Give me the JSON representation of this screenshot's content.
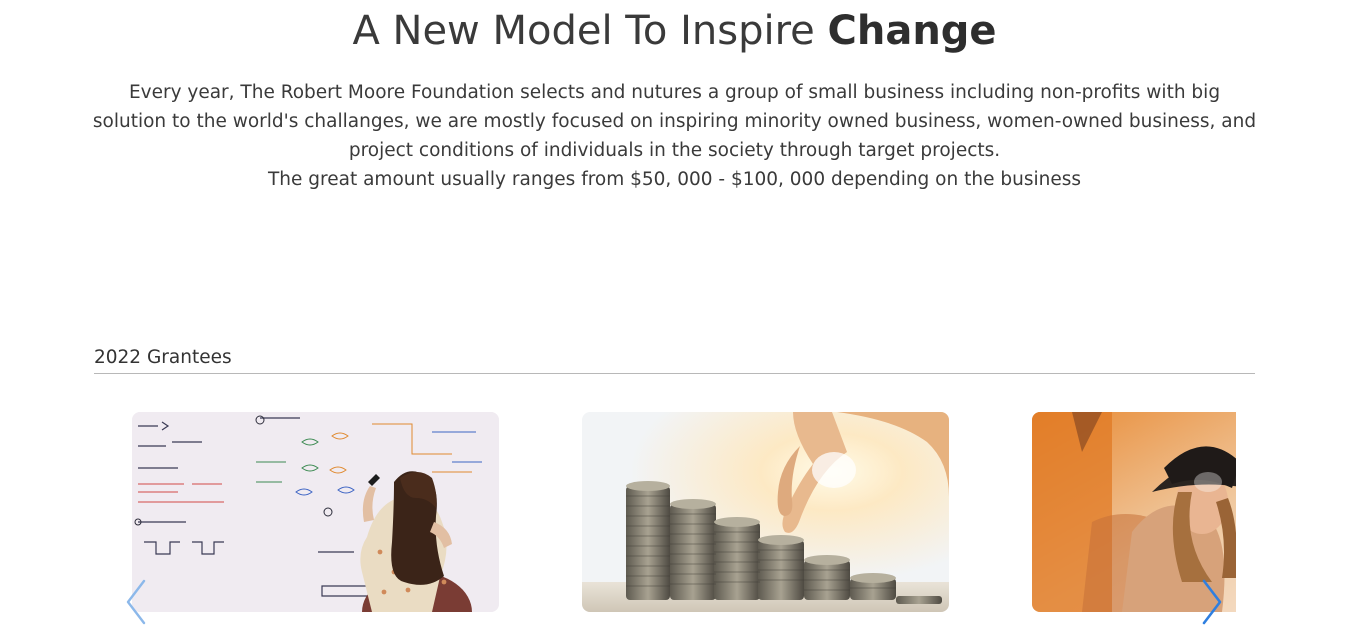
{
  "hero": {
    "title_regular": "A New Model To Inspire ",
    "title_bold": "Change"
  },
  "intro": {
    "paragraph": "Every year, The Robert Moore Foundation selects and nutures a group of small business including non-profits with big solution to the world's challanges, we are mostly focused on inspiring minority owned business, women-owned business, and project conditions of individuals in the society through target projects.",
    "amount_line": "The great amount usually ranges from $50, 000 - $100, 000 depending on the business"
  },
  "grantees": {
    "section_title": "2022 Grantees",
    "cards": [
      {
        "image": "whiteboard-digital-logic-photo"
      },
      {
        "image": "stacked-coins-photo"
      },
      {
        "image": "woman-in-hat-photo"
      }
    ]
  },
  "carousel": {
    "prev_icon": "chevron-left-icon",
    "next_icon": "chevron-right-icon",
    "accent": "#2f7fe0"
  }
}
